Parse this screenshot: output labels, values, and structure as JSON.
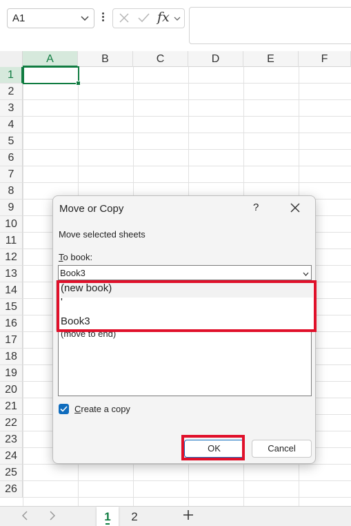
{
  "formula_bar": {
    "name_box_value": "A1",
    "fx_label": "fx",
    "formula_value": ""
  },
  "grid": {
    "columns": [
      "A",
      "B",
      "C",
      "D",
      "E",
      "F"
    ],
    "rows": [
      "1",
      "2",
      "3",
      "4",
      "5",
      "6",
      "7",
      "8",
      "9",
      "10",
      "11",
      "12",
      "13",
      "14",
      "15",
      "16",
      "17",
      "18",
      "19",
      "20",
      "21",
      "22",
      "23",
      "24",
      "25",
      "26"
    ],
    "selected_cell": "A1",
    "accent_color": "#107c41"
  },
  "sheet_tabs": {
    "tabs": [
      "1",
      "2"
    ],
    "active_tab": "1"
  },
  "dialog": {
    "title": "Move or Copy",
    "help_label": "?",
    "subtitle": "Move selected sheets",
    "to_book_label_underlined": "T",
    "to_book_label_rest": "o book:",
    "to_book_value": "Book3",
    "before_list_partial_item": "(move to end)",
    "dropdown_options": [
      "(new book)",
      "'",
      "Book3"
    ],
    "create_copy_checked": true,
    "create_copy_label_underlined": "C",
    "create_copy_label_rest": "reate a copy",
    "ok_label": "OK",
    "cancel_label": "Cancel",
    "highlight_color": "#e0102a",
    "checkbox_color": "#0f6cbd"
  }
}
